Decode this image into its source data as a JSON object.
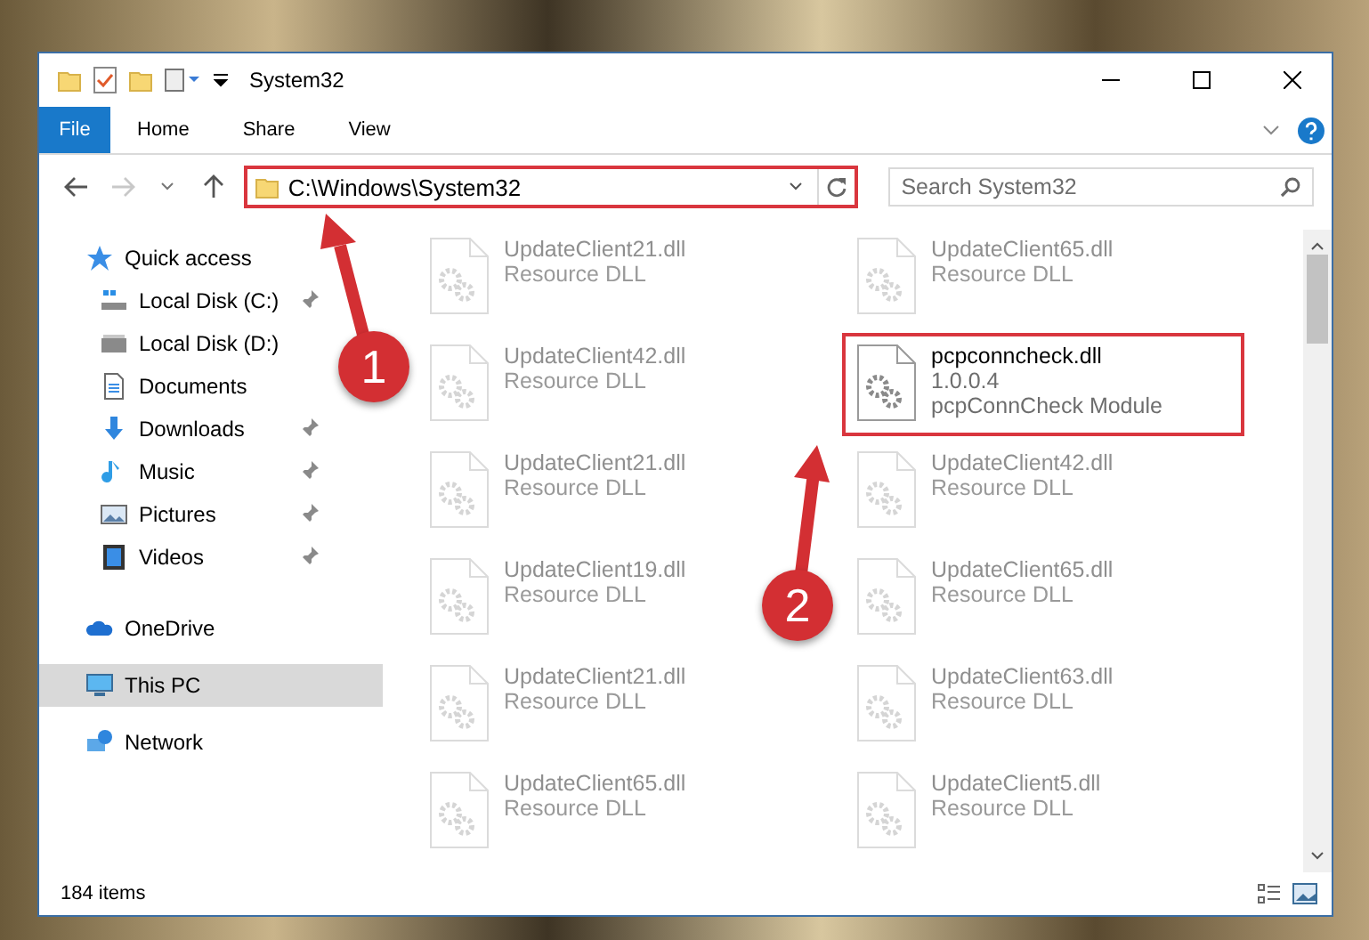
{
  "window": {
    "title": "System32"
  },
  "ribbon": {
    "tabs": [
      {
        "label": "File",
        "selected": true
      },
      {
        "label": "Home",
        "selected": false
      },
      {
        "label": "Share",
        "selected": false
      },
      {
        "label": "View",
        "selected": false
      }
    ]
  },
  "address": {
    "path": "C:\\Windows\\System32",
    "highlighted": true
  },
  "search": {
    "placeholder": "Search System32"
  },
  "sidebar": {
    "items": [
      {
        "label": "Quick access",
        "kind": "star",
        "selected": false,
        "children": [
          {
            "label": "Local Disk (C:)",
            "kind": "drive-win",
            "pinned": true,
            "selected": false
          },
          {
            "label": "Local Disk (D:)",
            "kind": "drive",
            "pinned": false,
            "selected": false
          },
          {
            "label": "Documents",
            "kind": "documents",
            "pinned": false,
            "selected": false
          },
          {
            "label": "Downloads",
            "kind": "downloads",
            "pinned": true,
            "selected": false
          },
          {
            "label": "Music",
            "kind": "music",
            "pinned": true,
            "selected": false
          },
          {
            "label": "Pictures",
            "kind": "pictures",
            "pinned": true,
            "selected": false
          },
          {
            "label": "Videos",
            "kind": "videos",
            "pinned": true,
            "selected": false
          }
        ]
      },
      {
        "label": "OneDrive",
        "kind": "cloud",
        "selected": false
      },
      {
        "label": "This PC",
        "kind": "pc",
        "selected": true
      },
      {
        "label": "Network",
        "kind": "network",
        "selected": false
      }
    ]
  },
  "files": [
    {
      "name": "UpdateClient21.dll",
      "details": [
        "Resource DLL"
      ],
      "faded": true,
      "highlighted": false
    },
    {
      "name": "UpdateClient65.dll",
      "details": [
        "Resource DLL"
      ],
      "faded": true,
      "highlighted": false
    },
    {
      "name": "UpdateClient42.dll",
      "details": [
        "Resource DLL"
      ],
      "faded": true,
      "highlighted": false
    },
    {
      "name": "pcpconncheck.dll",
      "details": [
        "1.0.0.4",
        "pcpConnCheck Module"
      ],
      "faded": false,
      "highlighted": true
    },
    {
      "name": "UpdateClient21.dll",
      "details": [
        "Resource DLL"
      ],
      "faded": true,
      "highlighted": false
    },
    {
      "name": "UpdateClient42.dll",
      "details": [
        "Resource DLL"
      ],
      "faded": true,
      "highlighted": false
    },
    {
      "name": "UpdateClient19.dll",
      "details": [
        "Resource DLL"
      ],
      "faded": true,
      "highlighted": false
    },
    {
      "name": "UpdateClient65.dll",
      "details": [
        "Resource DLL"
      ],
      "faded": true,
      "highlighted": false
    },
    {
      "name": "UpdateClient21.dll",
      "details": [
        "Resource DLL"
      ],
      "faded": true,
      "highlighted": false
    },
    {
      "name": "UpdateClient63.dll",
      "details": [
        "Resource DLL"
      ],
      "faded": true,
      "highlighted": false
    },
    {
      "name": "UpdateClient65.dll",
      "details": [
        "Resource DLL"
      ],
      "faded": true,
      "highlighted": false
    },
    {
      "name": "UpdateClient5.dll",
      "details": [
        "Resource DLL"
      ],
      "faded": true,
      "highlighted": false
    }
  ],
  "status_bar": {
    "count": "184 items"
  },
  "annotations": [
    {
      "number": "1"
    },
    {
      "number": "2"
    }
  ]
}
